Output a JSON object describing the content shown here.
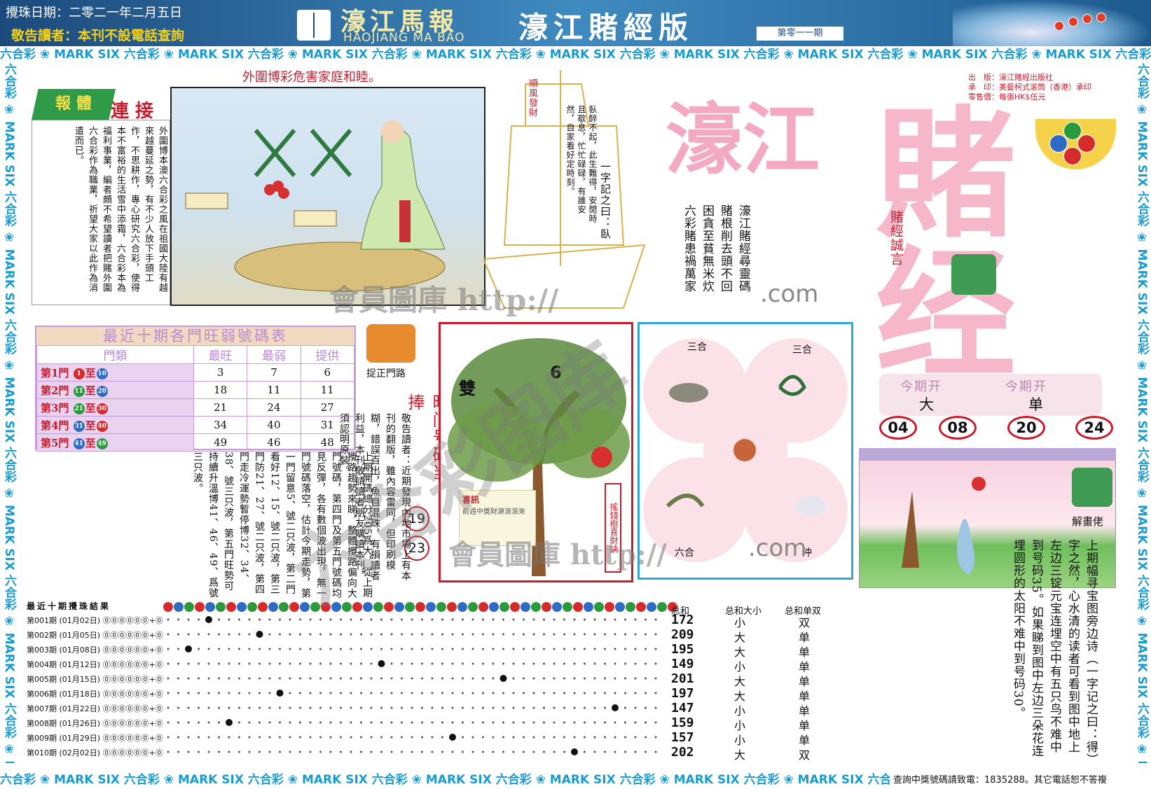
{
  "header": {
    "date": "攪珠日期：二零二一年二月五日",
    "notice": "敬告讀者：本刊不設電話查詢",
    "logo_zh": "濠江馬報",
    "logo_en": "HAOJIANG MA BAO",
    "edition": "濠江賭經版",
    "issue": "第零一一期"
  },
  "bands": {
    "repeat": "六合彩 ❀ MARK SIX "
  },
  "article": {
    "tag": "報 體",
    "tag_sub": "連 接",
    "banner": "外圍博彩危害家庭和睦。",
    "text": "外圍博本澳六合彩之風在祖國大陸有越來越蔓延之勢，有不少人放下手頭工作，不思耕作，專心研究六合彩，使得本不富裕的生活雪中添霜，六合彩本為福利事業，編者頗不希望讀者把賭外圍六合彩作為職業，祈望大家以此作為消遣而已。"
  },
  "sail": {
    "flag": "順風發財",
    "text": "臥醉不起，此生難得，安閒時且歇息，忙忙碌碌，有誰安然，自家看好定時刻。",
    "quote": "一字記之曰：臥"
  },
  "poem": {
    "lines": [
      "六彩賭患禍萬家",
      "困貪至貧無米炊",
      "賭根削去頭不回",
      "濠江賭經尋靈碼"
    ],
    "com": ".com"
  },
  "logo": {
    "big1": "濠江",
    "big2": "賭经",
    "motto": "賭經誠言",
    "pub": [
      "出　版：濠江賭經出版社",
      "承　印：美藝柯式滚筒（香港）承印",
      "零售價：每張HK$伍元"
    ]
  },
  "table": {
    "title": "最近十期各門旺弱號碼表",
    "headers": [
      "門類",
      "最旺",
      "最弱",
      "提供"
    ],
    "rows": [
      {
        "gate": "第1門",
        "a": "1",
        "b": "10",
        "c": "bR",
        "d": "bB",
        "hi": "3",
        "lo": "7",
        "tip": "6"
      },
      {
        "gate": "第2門",
        "a": "11",
        "b": "20",
        "c": "bG",
        "d": "bB",
        "hi": "18",
        "lo": "11",
        "tip": "11"
      },
      {
        "gate": "第3門",
        "a": "21",
        "b": "30",
        "c": "bG",
        "d": "bR",
        "hi": "21",
        "lo": "24",
        "tip": "27"
      },
      {
        "gate": "第4門",
        "a": "31",
        "b": "40",
        "c": "bB",
        "d": "bR",
        "hi": "34",
        "lo": "40",
        "tip": "31"
      },
      {
        "gate": "第5門",
        "a": "41",
        "b": "49",
        "c": "bB",
        "d": "bG",
        "hi": "49",
        "lo": "46",
        "tip": "48"
      }
    ],
    "to": "至"
  },
  "middle": {
    "grab_label": "捉正門路",
    "red_head": "旺门号码当捧",
    "nums": [
      "19",
      "23"
    ],
    "note": "敬告讀者：近期發現內地市場上有本刊的翻版，雖內容雷同，但印刷模糊，錯誤百出，魚目混珠，有損讀者利益，本刊敬請讀者朋友購讀本刊，須認明原裝。",
    "notice2": "上期開碼總分205爲大，從上期攪路趨勢來睇，整體攪路偏向大門號碼，第四門及第五門號碼均見反彈，各有數個波出現，無一門號碼落空，估計今期走勢，第一門留意5、號二只波，第二門看好12、15、號二只波，第三門防21、27、號二只波，第四門走冷運勢暫停博32、34、38、號三只波，第五門旺勢可持續升溫博41、46、49、爲號三只波。"
  },
  "tree": {
    "word": "雙",
    "num": "6",
    "caption": "搖錢樹喜財訣",
    "box_title": "喜訊",
    "box_text": "前週中獎財源滾滾來"
  },
  "zodiac": {
    "labels": [
      "三合",
      "三合",
      "六合",
      "沖"
    ],
    "com": ".com"
  },
  "result": {
    "h1": "今期开",
    "h2": "今期开",
    "v1": "大",
    "v2": "单",
    "nums": [
      "04",
      "08",
      "20",
      "24"
    ]
  },
  "explain": {
    "label": "解畫佬",
    "text": "上期幅寻宝图旁边诗（一字记之曰：得）字之然，心水清的读者可看到图中地上左边三锭元宝连埋空中有五只鸟不难中到号码35。如果睇到图中左边三朵花连埋圆形的太阳不难中到号码30。"
  },
  "draws": {
    "title": "最近十期攪珠結果",
    "col_sum": "总和",
    "col_size": "总和大小",
    "col_parity": "总和单双",
    "rows": [
      {
        "label": "第001期 (01月02日) ⓪⓪⓪⓪⓪⓪+⓪",
        "sum": "172",
        "size": "小",
        "parity": "双"
      },
      {
        "label": "第002期 (01月05日) ⓪⓪⓪⓪⓪⓪+⓪",
        "sum": "209",
        "size": "大",
        "parity": "单"
      },
      {
        "label": "第003期 (01月08日) ⓪⓪⓪⓪⓪⓪+⓪",
        "sum": "195",
        "size": "大",
        "parity": "单"
      },
      {
        "label": "第004期 (01月12日) ⓪⓪⓪⓪⓪⓪+⓪",
        "sum": "149",
        "size": "小",
        "parity": "单"
      },
      {
        "label": "第005期 (01月15日) ⓪⓪⓪⓪⓪⓪+⓪",
        "sum": "201",
        "size": "大",
        "parity": "单"
      },
      {
        "label": "第006期 (01月18日) ⓪⓪⓪⓪⓪⓪+⓪",
        "sum": "197",
        "size": "大",
        "parity": "单"
      },
      {
        "label": "第007期 (01月22日) ⓪⓪⓪⓪⓪⓪+⓪",
        "sum": "147",
        "size": "小",
        "parity": "单"
      },
      {
        "label": "第008期 (01月26日) ⓪⓪⓪⓪⓪⓪+⓪",
        "sum": "159",
        "size": "小",
        "parity": "单"
      },
      {
        "label": "第009期 (01月29日) ⓪⓪⓪⓪⓪⓪+⓪",
        "sum": "157",
        "size": "小",
        "parity": "单"
      },
      {
        "label": "第010期 (02月02日) ⓪⓪⓪⓪⓪⓪+⓪",
        "sum": "202",
        "size": "大",
        "parity": "双"
      }
    ]
  },
  "footer": {
    "hotline": "查詢中獎號碼請致電：1835288。其它電話恕不答複"
  },
  "watermarks": {
    "w1": "會員圖庫 http://",
    "w2": "六合彩图库",
    "w3": "會員圖庫 http://"
  },
  "colors": {
    "accent": "#c81c2d",
    "band": "#1a9bd0",
    "header": "#1c4a7c"
  }
}
